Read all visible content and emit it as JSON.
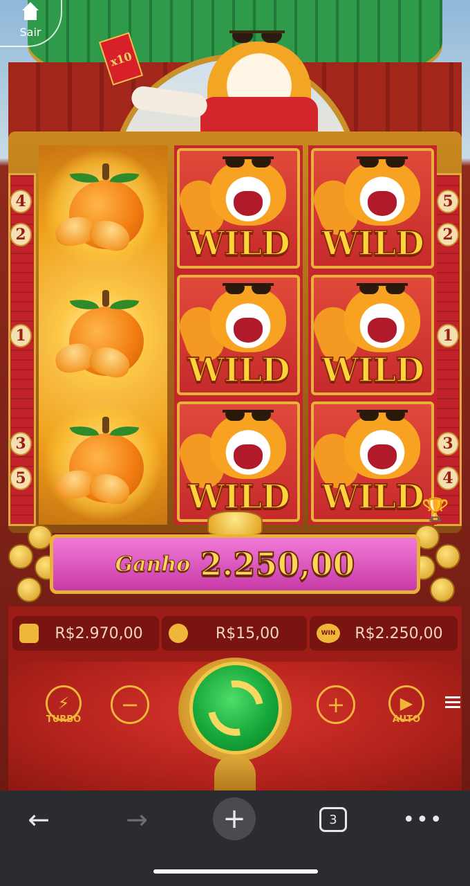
{
  "exit": {
    "label": "Sair"
  },
  "header_banner": {
    "multiplier": "x10"
  },
  "paylines": {
    "left_top": [
      "4",
      "2"
    ],
    "left_mid": "1",
    "left_bottom": [
      "3",
      "5"
    ],
    "right_top": [
      "5",
      "2"
    ],
    "right_mid": "1",
    "right_bottom": [
      "3",
      "4"
    ]
  },
  "reels": [
    {
      "symbols": [
        "orange",
        "orange",
        "orange"
      ]
    },
    {
      "symbols": [
        "WILD",
        "WILD",
        "WILD"
      ]
    },
    {
      "symbols": [
        "WILD",
        "WILD",
        "WILD"
      ]
    }
  ],
  "wild_text": "WILD",
  "win": {
    "label": "Ganho",
    "value": "2.250,00"
  },
  "info": {
    "balance": "R$2.970,00",
    "bet": "R$15,00",
    "win_icon_text": "WIN",
    "last_win": "R$2.250,00"
  },
  "controls": {
    "turbo_label": "TURBO",
    "auto_label": "AUTO"
  },
  "browser": {
    "tab_count": "3"
  },
  "colors": {
    "banner": "#d84ab8",
    "frame_gold": "#e8b23a",
    "spin_green": "#16a83a",
    "panel_red": "#b2221c"
  }
}
